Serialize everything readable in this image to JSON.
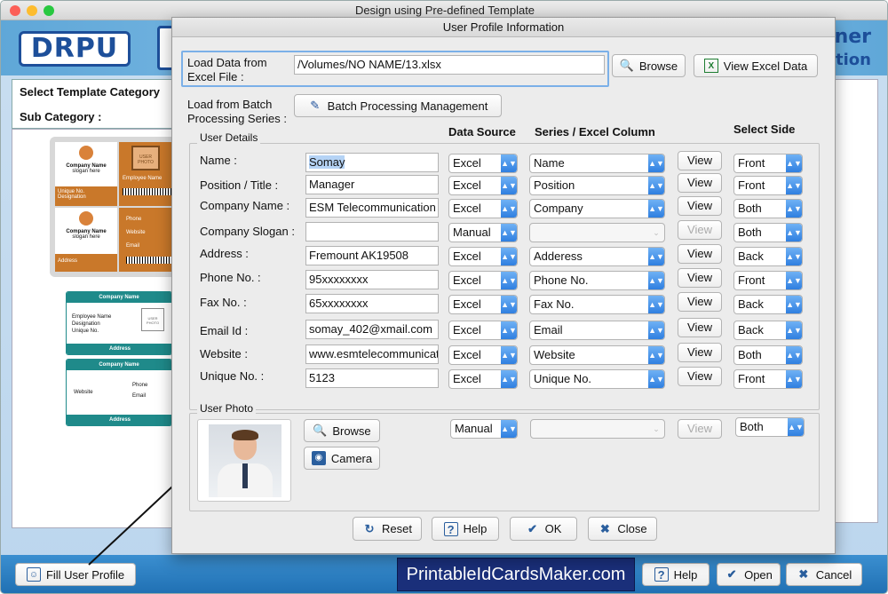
{
  "app": {
    "window_title": "Design using Pre-defined Template",
    "banner_right_line1": "ner",
    "banner_right_line2": "tion"
  },
  "left_panel": {
    "select_template_category": "Select Template Category",
    "sub_category": "Sub Category :"
  },
  "template_previews": {
    "card1_company_name": "Company Name",
    "card1_slogan": "slogan here",
    "card1_unique_no": "Unique No.",
    "card1_designation": "Designation",
    "card1_employee_name": "Employee Name",
    "card1_photo": "USER PHOTO",
    "card1_phone": "Phone",
    "card1_website": "Website",
    "card1_email": "Email",
    "card1_address": "Address",
    "card2_company_name": "Company Name",
    "card2_employee_name": "Employee Name",
    "card2_designation": "Designation",
    "card2_unique_no": "Unique No.",
    "card2_photo": "USER PHOTO",
    "card2_address": "Address",
    "card2_website": "Website",
    "card2_phone": "Phone",
    "card2_email": "Email"
  },
  "dialog": {
    "title": "User Profile Information",
    "load_excel_label_1": "Load Data from",
    "load_excel_label_2": "Excel File :",
    "excel_path": "/Volumes/NO NAME/13.xlsx",
    "browse_label": "Browse",
    "view_excel_label": "View Excel Data",
    "batch_label_1": "Load from Batch",
    "batch_label_2": "Processing Series :",
    "batch_button": "Batch Processing Management",
    "user_details_legend": "User Details",
    "col_data_source": "Data Source",
    "col_series": "Series / Excel Column",
    "col_select_side": "Select Side",
    "view_label": "View",
    "fields": [
      {
        "label": "Name :",
        "value": "Somay",
        "source": "Excel",
        "column": "Name",
        "side": "Front",
        "enabled": true
      },
      {
        "label": "Position / Title :",
        "value": "Manager",
        "source": "Excel",
        "column": "Position",
        "side": "Front",
        "enabled": true
      },
      {
        "label": "Company Name :",
        "value": "ESM Telecommunication L",
        "source": "Excel",
        "column": "Company",
        "side": "Both",
        "enabled": true
      },
      {
        "label": "Company Slogan :",
        "value": "",
        "source": "Manual",
        "column": "",
        "side": "Both",
        "enabled": false
      },
      {
        "label": "Address :",
        "value": "Fremount AK19508",
        "source": "Excel",
        "column": "Adderess",
        "side": "Back",
        "enabled": true
      },
      {
        "label": "Phone No. :",
        "value": "95xxxxxxxx",
        "source": "Excel",
        "column": "Phone No.",
        "side": "Front",
        "enabled": true
      },
      {
        "label": "Fax No. :",
        "value": "65xxxxxxxx",
        "source": "Excel",
        "column": "Fax No.",
        "side": "Back",
        "enabled": true
      },
      {
        "label": "Email Id :",
        "value": "somay_402@xmail.com",
        "source": "Excel",
        "column": "Email",
        "side": "Back",
        "enabled": true
      },
      {
        "label": "Website :",
        "value": "www.esmtelecommunicat",
        "source": "Excel",
        "column": "Website",
        "side": "Both",
        "enabled": true
      },
      {
        "label": "Unique No. :",
        "value": "5123",
        "source": "Excel",
        "column": "Unique No.",
        "side": "Front",
        "enabled": true
      }
    ],
    "user_photo_legend": "User Photo",
    "photo_browse": "Browse",
    "photo_camera": "Camera",
    "photo_source": "Manual",
    "photo_column": "",
    "photo_side": "Both",
    "reset": "Reset",
    "help": "Help",
    "ok": "OK",
    "close": "Close"
  },
  "bottom": {
    "fill_user_profile": "Fill User Profile",
    "brand": "PrintableIdCardsMaker.com",
    "help": "Help",
    "open": "Open",
    "cancel": "Cancel"
  },
  "colors": {
    "accent_blue": "#2f7fe0",
    "brand_bg": "#1a2f7a",
    "card_orange": "#c9782a",
    "card_teal": "#1f8a8a"
  }
}
